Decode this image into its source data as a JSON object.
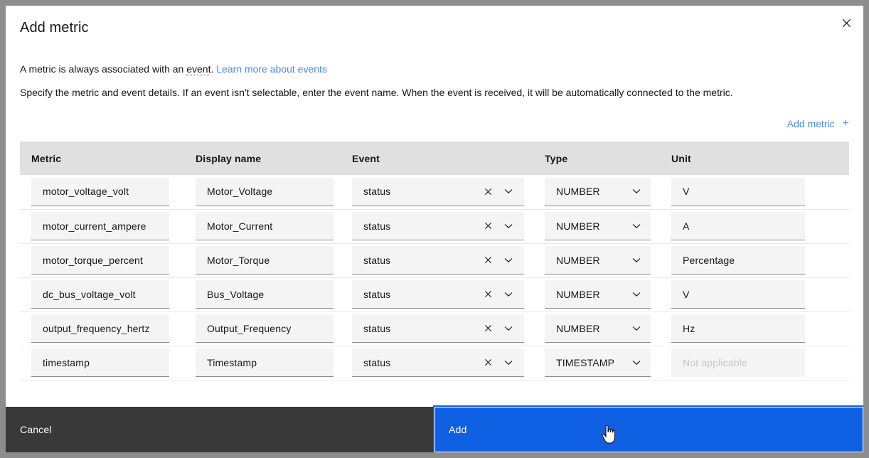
{
  "dialog": {
    "title": "Add metric",
    "close_label": "Close",
    "intro_line1_before": "A metric is always associated with an ",
    "intro_line1_term": "event",
    "intro_line1_after": ". ",
    "intro_line1_link": "Learn more about events",
    "intro_line2": "Specify the metric and event details. If an event isn't selectable, enter the event name. When the event is received, it will be automatically connected to the metric.",
    "add_metric_label": "Add metric",
    "add_metric_plus": "+"
  },
  "table": {
    "headers": [
      "Metric",
      "Display name",
      "Event",
      "Type",
      "Unit"
    ],
    "rows": [
      {
        "metric": "motor_voltage_volt",
        "display_name": "Motor_Voltage",
        "event": "status",
        "type": "NUMBER",
        "unit": "V",
        "unit_disabled": false
      },
      {
        "metric": "motor_current_ampere",
        "display_name": "Motor_Current",
        "event": "status",
        "type": "NUMBER",
        "unit": "A",
        "unit_disabled": false
      },
      {
        "metric": "motor_torque_percent",
        "display_name": "Motor_Torque",
        "event": "status",
        "type": "NUMBER",
        "unit": "Percentage",
        "unit_disabled": false
      },
      {
        "metric": "dc_bus_voltage_volt",
        "display_name": "Bus_Voltage",
        "event": "status",
        "type": "NUMBER",
        "unit": "V",
        "unit_disabled": false
      },
      {
        "metric": "output_frequency_hertz",
        "display_name": "Output_Frequency",
        "event": "status",
        "type": "NUMBER",
        "unit": "Hz",
        "unit_disabled": false
      },
      {
        "metric": "timestamp",
        "display_name": "Timestamp",
        "event": "status",
        "type": "TIMESTAMP",
        "unit": "Not applicable",
        "unit_disabled": true
      }
    ]
  },
  "footer": {
    "cancel_label": "Cancel",
    "add_label": "Add"
  },
  "colors": {
    "accent_link": "#4589ff",
    "primary_button": "#0f5fe3",
    "footer_bg": "#393939",
    "table_header_bg": "#e0e0e0",
    "field_bg": "#f4f4f4",
    "backdrop": "#8d8d8d"
  },
  "icons": {
    "close": "close-icon",
    "clear": "clear-icon",
    "chevron_down": "chevron-down-icon",
    "plus": "plus-icon",
    "cursor": "pointer-hand-cursor"
  }
}
